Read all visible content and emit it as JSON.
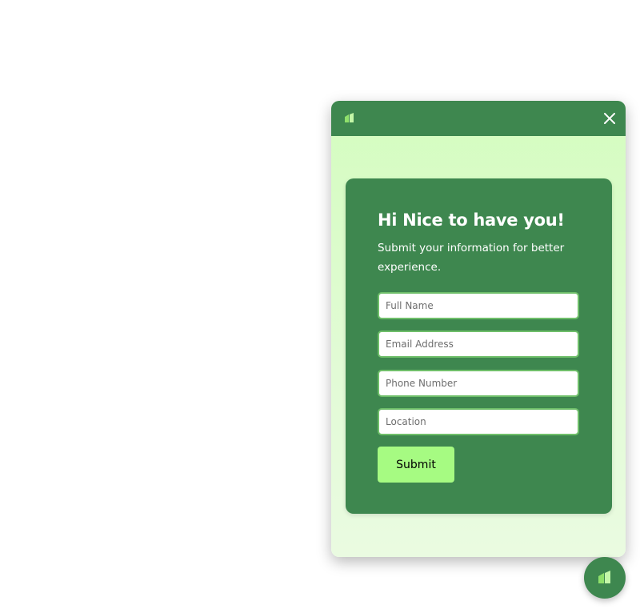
{
  "widget": {
    "logo_icon": "brand-logo-icon",
    "close_icon": "close-icon",
    "accent_color": "#3e874f",
    "background_color": "#d4fdbf"
  },
  "form": {
    "title": "Hi Nice to have you!",
    "subtitle": "Submit your information for better experience.",
    "fields": {
      "full_name": {
        "placeholder": "Full Name",
        "value": ""
      },
      "email": {
        "placeholder": "Email Address",
        "value": ""
      },
      "phone": {
        "placeholder": "Phone Number",
        "value": ""
      },
      "location": {
        "placeholder": "Location",
        "value": ""
      }
    },
    "submit_label": "Submit",
    "submit_color": "#a6fb82"
  },
  "launcher": {
    "icon": "brand-logo-icon",
    "color": "#3e874f"
  }
}
